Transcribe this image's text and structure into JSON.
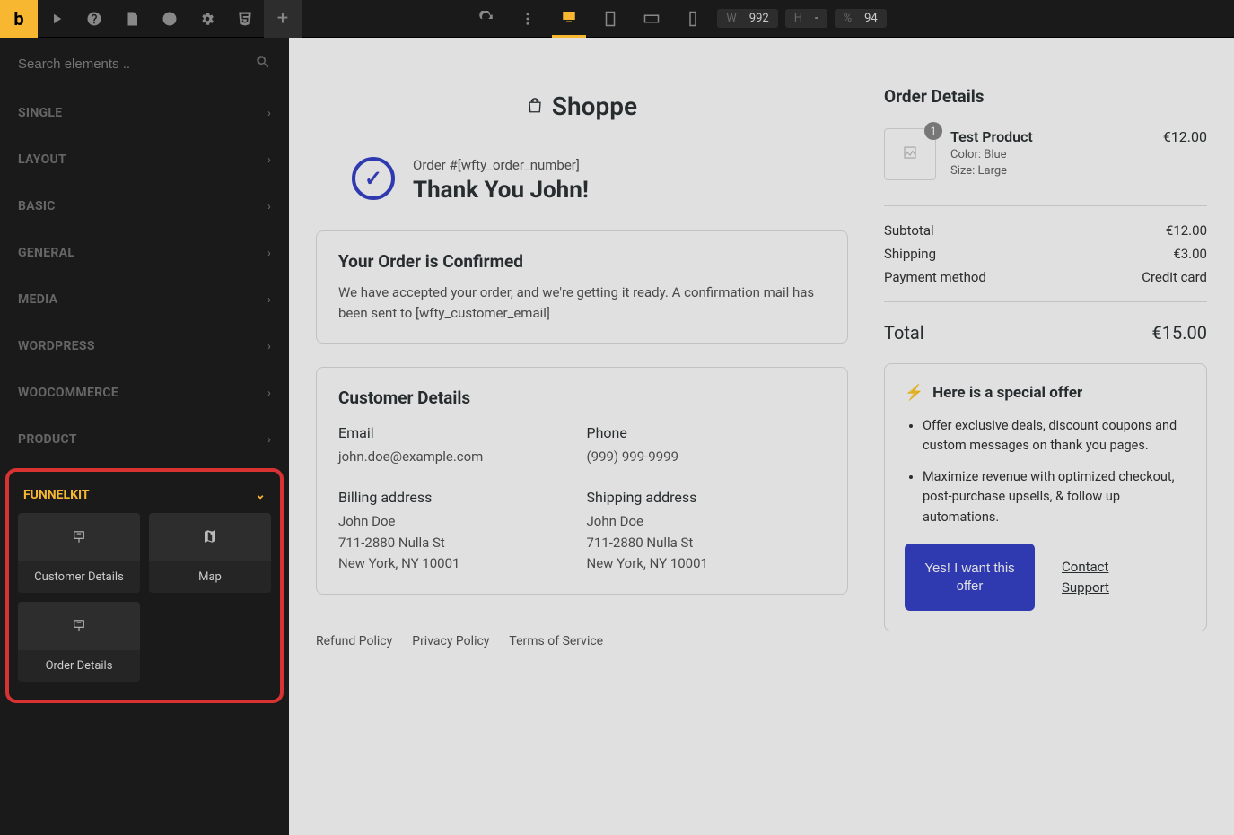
{
  "topbar": {
    "logo": "b",
    "dims": {
      "w_label": "W",
      "w": "992",
      "h_label": "H",
      "h": "-",
      "pct_label": "%",
      "pct": "94"
    }
  },
  "sidebar": {
    "search_placeholder": "Search elements ..",
    "categories": [
      "Single",
      "Layout",
      "Basic",
      "General",
      "Media",
      "WordPress",
      "WooCommerce",
      "Product"
    ],
    "funnelkit": {
      "title": "FUNNELKIT",
      "tiles": [
        "Customer Details",
        "Map",
        "Order Details"
      ]
    }
  },
  "page": {
    "brand": "Shoppe",
    "order_line": "Order #[wfty_order_number]",
    "thank_you": "Thank You John!",
    "confirm": {
      "title": "Your Order is Confirmed",
      "body": "We have accepted your order, and we're getting it ready. A confirmation mail has been sent to [wfty_customer_email]"
    },
    "customer": {
      "title": "Customer Details",
      "email_label": "Email",
      "email": "john.doe@example.com",
      "phone_label": "Phone",
      "phone": "(999) 999-9999",
      "billing_label": "Billing address",
      "billing": "John Doe\n711-2880 Nulla St\nNew York, NY 10001",
      "shipping_label": "Shipping address",
      "shipping": "John Doe\n711-2880 Nulla St\nNew York, NY 10001"
    },
    "footer": [
      "Refund Policy",
      "Privacy Policy",
      "Terms of Service"
    ]
  },
  "order": {
    "title": "Order Details",
    "product": {
      "name": "Test Product",
      "qty": "1",
      "meta1": "Color: Blue",
      "meta2": "Size: Large",
      "price": "€12.00"
    },
    "rows": [
      {
        "label": "Subtotal",
        "value": "€12.00"
      },
      {
        "label": "Shipping",
        "value": "€3.00"
      },
      {
        "label": "Payment method",
        "value": "Credit card"
      }
    ],
    "total_label": "Total",
    "total": "€15.00"
  },
  "offer": {
    "title": "Here is a special offer",
    "bullets": [
      "Offer exclusive deals, discount coupons and custom messages on thank you pages.",
      "Maximize revenue with optimized checkout, post-purchase upsells, & follow up automations."
    ],
    "cta": "Yes! I want this offer",
    "support": "Contact Support"
  }
}
